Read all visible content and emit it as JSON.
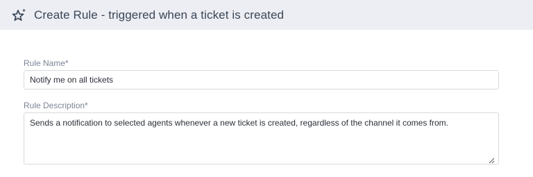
{
  "header": {
    "title": "Create Rule - triggered when a ticket is created",
    "icon": "sparkle-star-icon"
  },
  "form": {
    "rule_name": {
      "label": "Rule Name*",
      "value": "Notify me on all tickets"
    },
    "rule_description": {
      "label": "Rule Description*",
      "value": "Sends a notification to selected agents whenever a new ticket is created, regardless of the channel it comes from."
    }
  },
  "colors": {
    "header_bg": "#eceef3",
    "border": "#d6d9de",
    "label": "#7b8494",
    "title": "#3a4556"
  }
}
